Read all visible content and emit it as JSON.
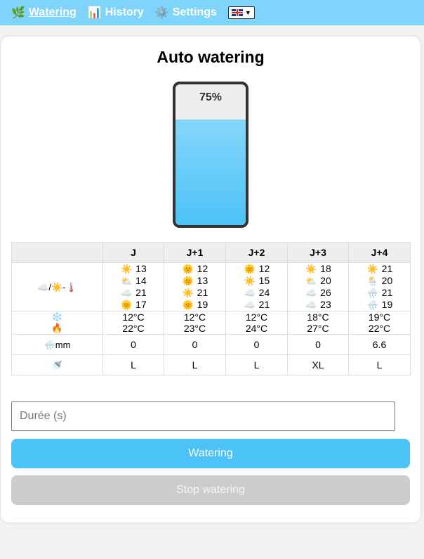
{
  "nav": {
    "items": [
      {
        "icon": "🌿",
        "label": "Watering",
        "active": true
      },
      {
        "icon": "📊",
        "label": "History",
        "active": false
      },
      {
        "icon": "⚙️",
        "label": "Settings",
        "active": false
      }
    ],
    "language": "English (UK flag)"
  },
  "main": {
    "title": "Auto watering",
    "tank_level_label": "75%",
    "tank_level_fraction": 0.75,
    "tank_fill_color": "#4cc3f7"
  },
  "table": {
    "headers": [
      "",
      "J",
      "J+1",
      "J+2",
      "J+3",
      "J+4"
    ],
    "row_icons": {
      "weather": "☁️/☀️-🌡️",
      "temp_min": "❄️",
      "temp_max": "🔥",
      "rain": "🌧️mm",
      "shower": "🚿"
    },
    "days": [
      {
        "weather": [
          [
            "☀️",
            "13"
          ],
          [
            "⛅",
            "14"
          ],
          [
            "☁️",
            "21"
          ],
          [
            "🌞",
            "17"
          ]
        ],
        "tmin": "12°C",
        "tmax": "22°C",
        "rain": "0",
        "size": "L"
      },
      {
        "weather": [
          [
            "🌞",
            "12"
          ],
          [
            "🌞",
            "13"
          ],
          [
            "☀️",
            "21"
          ],
          [
            "🌞",
            "19"
          ]
        ],
        "tmin": "12°C",
        "tmax": "23°C",
        "rain": "0",
        "size": "L"
      },
      {
        "weather": [
          [
            "🌞",
            "12"
          ],
          [
            "☀️",
            "15"
          ],
          [
            "☁️",
            "24"
          ],
          [
            "☁️",
            "21"
          ]
        ],
        "tmin": "12°C",
        "tmax": "24°C",
        "rain": "0",
        "size": "L"
      },
      {
        "weather": [
          [
            "☀️",
            "18"
          ],
          [
            "⛅",
            "20"
          ],
          [
            "☁️",
            "26"
          ],
          [
            "☁️",
            "23"
          ]
        ],
        "tmin": "18°C",
        "tmax": "27°C",
        "rain": "0",
        "size": "XL"
      },
      {
        "weather": [
          [
            "☀️",
            "21"
          ],
          [
            "🌦️",
            "20"
          ],
          [
            "🌧️",
            "21"
          ],
          [
            "🌧️",
            "19"
          ]
        ],
        "tmin": "19°C",
        "tmax": "22°C",
        "rain": "6.6",
        "size": "L"
      }
    ]
  },
  "form": {
    "duration_placeholder": "Durée (s)",
    "duration_value": "",
    "water_label": "Watering",
    "stop_label": "Stop watering"
  },
  "colors": {
    "nav_bg": "#7ed4fb",
    "accent": "#4cc3f7",
    "disabled": "#cccccc"
  }
}
